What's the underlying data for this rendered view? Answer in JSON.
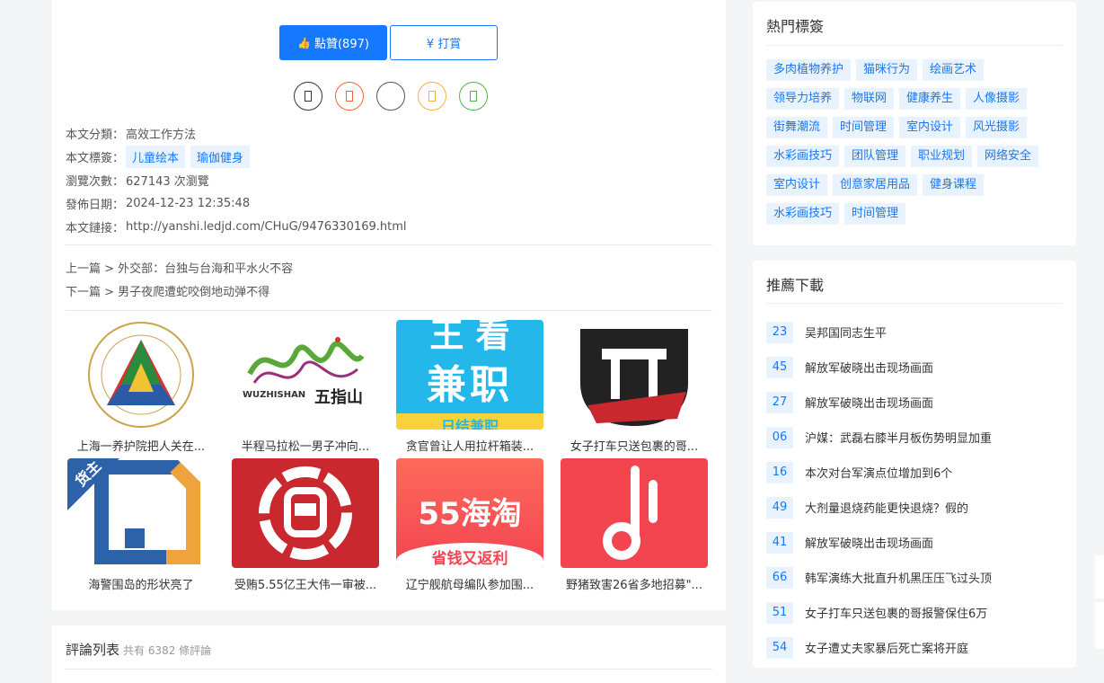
{
  "actions": {
    "like_label": "點贊(897)",
    "reward_label": "¥ 打賞"
  },
  "share_icons": [
    {
      "name": "share-icon-1",
      "color": "#333333"
    },
    {
      "name": "share-icon-2",
      "color": "#f0642d"
    },
    {
      "name": "share-icon-3",
      "color": "#555555"
    },
    {
      "name": "share-icon-4",
      "color": "#f0b43c"
    },
    {
      "name": "share-icon-5",
      "color": "#52b24a"
    }
  ],
  "meta": {
    "category_label": "本文分類：",
    "category_value": "高效工作方法",
    "tags_label": "本文標簽：",
    "tags": [
      "儿童绘本",
      "瑜伽健身"
    ],
    "views_label": "瀏覽次數：",
    "views_value": "627143 次瀏覽",
    "date_label": "發佈日期：",
    "date_value": "2024-12-23 12:35:48",
    "link_label": "本文鏈接：",
    "link_value": "http://yanshi.ledjd.com/CHuG/9476330169.html"
  },
  "nav": {
    "prev": "上一篇 > 外交部：台独与台海和平水火不容",
    "next": "下一篇 > 男子夜爬遭蛇咬倒地动弹不得"
  },
  "related": [
    {
      "caption": "上海一养护院把人关在..."
    },
    {
      "caption": "半程马拉松一男子冲向..."
    },
    {
      "caption": "贪官曾让人用拉杆箱装..."
    },
    {
      "caption": "女子打车只送包裹的哥..."
    },
    {
      "caption": "海警围岛的形状亮了"
    },
    {
      "caption": "受贿5.55亿王大伟一审被..."
    },
    {
      "caption": "辽宁舰航母编队参加围..."
    },
    {
      "caption": "野猪致害26省多地招募\"..."
    }
  ],
  "thumb_text": {
    "t2_brand": "WUZHISHAN",
    "t2_cn": "五指山",
    "t3_top": "王 看",
    "t3_mid": "兼职",
    "t3_bottom": "日结兼职",
    "t5_badge": "货主",
    "t7_main": "55海淘",
    "t7_sub": "省钱又返利"
  },
  "comments": {
    "title": "評論列表",
    "count": "共有 6382 條評論"
  },
  "hot_tags": {
    "title": "熱門標簽",
    "items": [
      "多肉植物养护",
      "猫咪行为",
      "绘画艺术",
      "领导力培养",
      "物联网",
      "健康养生",
      "人像摄影",
      "街舞潮流",
      "时间管理",
      "室内设计",
      "风光摄影",
      "水彩画技巧",
      "团队管理",
      "职业规划",
      "网络安全",
      "室内设计",
      "创意家居用品",
      "健身课程",
      "水彩画技巧",
      "时间管理"
    ]
  },
  "recommend": {
    "title": "推薦下載",
    "items": [
      {
        "num": "23",
        "text": "吴邦国同志生平"
      },
      {
        "num": "45",
        "text": "解放军破晓出击现场画面"
      },
      {
        "num": "27",
        "text": "解放军破晓出击现场画面"
      },
      {
        "num": "06",
        "text": "沪媒：武磊右膝半月板伤势明显加重"
      },
      {
        "num": "16",
        "text": "本次对台军演点位增加到6个"
      },
      {
        "num": "49",
        "text": "大剂量退烧药能更快退烧？假的"
      },
      {
        "num": "41",
        "text": "解放军破晓出击现场画面"
      },
      {
        "num": "66",
        "text": "韩军演练大批直升机黑压压飞过头顶"
      },
      {
        "num": "51",
        "text": "女子打车只送包裹的哥报警保住6万"
      },
      {
        "num": "54",
        "text": "女子遭丈夫家暴后死亡案将开庭"
      }
    ]
  }
}
